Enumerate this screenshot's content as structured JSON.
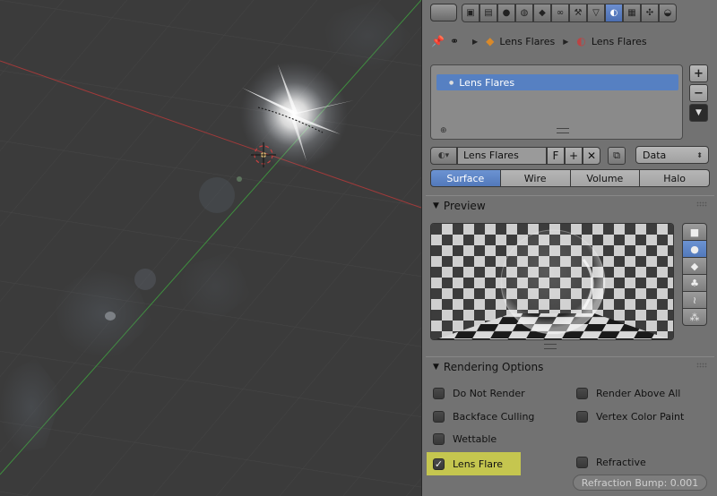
{
  "viewport": {
    "description_colors": {
      "grid": "#474747",
      "x_axis": "#a03a3a",
      "y_axis": "#3f8f3f"
    }
  },
  "toolbar": {
    "tabs": [
      "render-icon",
      "layers-icon",
      "scene-icon",
      "world-icon",
      "object-icon",
      "constraints-icon",
      "modifiers-icon",
      "data-icon",
      "material-icon",
      "texture-icon",
      "particles-icon",
      "physics-icon"
    ],
    "active_tab": "material-icon"
  },
  "breadcrumb": {
    "object": "Lens Flares",
    "material": "Lens Flares"
  },
  "slots": {
    "items": [
      {
        "label": "Lens Flares"
      }
    ],
    "add": "+",
    "remove": "−",
    "menu": "▼"
  },
  "datablock": {
    "name": "Lens Flares",
    "fake_user": "F",
    "new": "+",
    "unlink": "✕",
    "link_mode": "Data"
  },
  "material_type": {
    "tabs": [
      "Surface",
      "Wire",
      "Volume",
      "Halo"
    ],
    "active": "Surface"
  },
  "preview": {
    "title": "Preview"
  },
  "rendering": {
    "title": "Rendering Options",
    "options": {
      "do_not_render": {
        "label": "Do Not Render",
        "checked": false
      },
      "render_above_all": {
        "label": "Render Above All",
        "checked": false
      },
      "backface_culling": {
        "label": "Backface Culling",
        "checked": false
      },
      "vertex_color_paint": {
        "label": "Vertex Color Paint",
        "checked": false
      },
      "wettable": {
        "label": "Wettable",
        "checked": false
      },
      "lens_flare": {
        "label": "Lens Flare",
        "checked": true
      },
      "refractive": {
        "label": "Refractive",
        "checked": false
      }
    },
    "refraction_bump": "Refraction Bump: 0.001",
    "highlight_color": "#c5c64f",
    "accent_color": "#5680c2"
  }
}
